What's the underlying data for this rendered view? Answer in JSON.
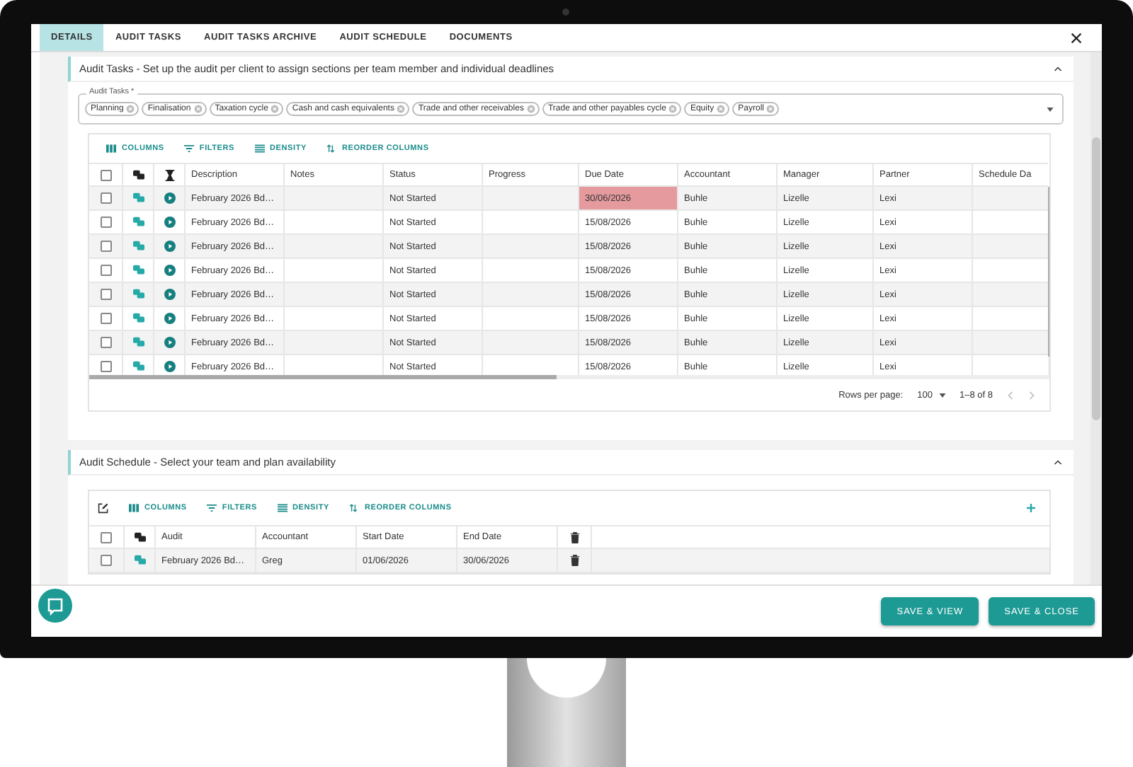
{
  "tabs": [
    {
      "label": "DETAILS",
      "selected": true
    },
    {
      "label": "AUDIT TASKS",
      "selected": false
    },
    {
      "label": "AUDIT TASKS ARCHIVE",
      "selected": false
    },
    {
      "label": "AUDIT SCHEDULE",
      "selected": false
    },
    {
      "label": "DOCUMENTS",
      "selected": false
    }
  ],
  "audit_tasks_panel": {
    "title": "Audit Tasks - Set up the audit per client to assign sections per team member and individual deadlines",
    "expanded": true,
    "field": {
      "label": "Audit Tasks *",
      "chips": [
        "Planning",
        "Finalisation",
        "Taxation cycle",
        "Cash and cash equivalents",
        "Trade and other receivables",
        "Trade and other payables cycle",
        "Equity",
        "Payroll"
      ]
    },
    "toolbar": [
      {
        "kind": "columns",
        "label": "COLUMNS"
      },
      {
        "kind": "filters",
        "label": "FILTERS"
      },
      {
        "kind": "density",
        "label": "DENSITY"
      },
      {
        "kind": "reorder",
        "label": "REORDER COLUMNS"
      }
    ],
    "table": {
      "all_checked": false,
      "columns": [
        "Description",
        "Notes",
        "Status",
        "Progress",
        "Due Date",
        "Accountant",
        "Manager",
        "Partner",
        "Schedule Da"
      ],
      "rows": [
        {
          "checked": false,
          "description": "February 2026 Bd…",
          "status": "Not Started",
          "due_date": "30/06/2026",
          "overdue": true,
          "accountant": "Buhle",
          "manager": "Lizelle",
          "partner": "Lexi"
        },
        {
          "checked": false,
          "description": "February 2026 Bd…",
          "status": "Not Started",
          "due_date": "15/08/2026",
          "overdue": false,
          "accountant": "Buhle",
          "manager": "Lizelle",
          "partner": "Lexi"
        },
        {
          "checked": false,
          "description": "February 2026 Bd…",
          "status": "Not Started",
          "due_date": "15/08/2026",
          "overdue": false,
          "accountant": "Buhle",
          "manager": "Lizelle",
          "partner": "Lexi"
        },
        {
          "checked": false,
          "description": "February 2026 Bd…",
          "status": "Not Started",
          "due_date": "15/08/2026",
          "overdue": false,
          "accountant": "Buhle",
          "manager": "Lizelle",
          "partner": "Lexi"
        },
        {
          "checked": false,
          "description": "February 2026 Bd…",
          "status": "Not Started",
          "due_date": "15/08/2026",
          "overdue": false,
          "accountant": "Buhle",
          "manager": "Lizelle",
          "partner": "Lexi"
        },
        {
          "checked": false,
          "description": "February 2026 Bd…",
          "status": "Not Started",
          "due_date": "15/08/2026",
          "overdue": false,
          "accountant": "Buhle",
          "manager": "Lizelle",
          "partner": "Lexi"
        },
        {
          "checked": false,
          "description": "February 2026 Bd…",
          "status": "Not Started",
          "due_date": "15/08/2026",
          "overdue": false,
          "accountant": "Buhle",
          "manager": "Lizelle",
          "partner": "Lexi"
        },
        {
          "checked": false,
          "description": "February 2026 Bd…",
          "status": "Not Started",
          "due_date": "15/08/2026",
          "overdue": false,
          "accountant": "Buhle",
          "manager": "Lizelle",
          "partner": "Lexi"
        }
      ]
    },
    "pagination": {
      "rows_per_page_label": "Rows per page:",
      "rows_per_page": "100",
      "range": "1–8 of 8"
    }
  },
  "audit_schedule_panel": {
    "title": "Audit Schedule - Select your team and plan availability",
    "expanded": true,
    "toolbar": [
      {
        "kind": "columns",
        "label": "COLUMNS"
      },
      {
        "kind": "filters",
        "label": "FILTERS"
      },
      {
        "kind": "density",
        "label": "DENSITY"
      },
      {
        "kind": "reorder",
        "label": "REORDER COLUMNS"
      }
    ],
    "table": {
      "all_checked": false,
      "columns": [
        "Audit",
        "Accountant",
        "Start Date",
        "End Date"
      ],
      "rows": [
        {
          "checked": false,
          "audit": "February 2026 Bd…",
          "accountant": "Greg",
          "start_date": "01/06/2026",
          "end_date": "30/06/2026"
        }
      ]
    }
  },
  "buttons": [
    "SAVE & VIEW",
    "SAVE & CLOSE"
  ]
}
